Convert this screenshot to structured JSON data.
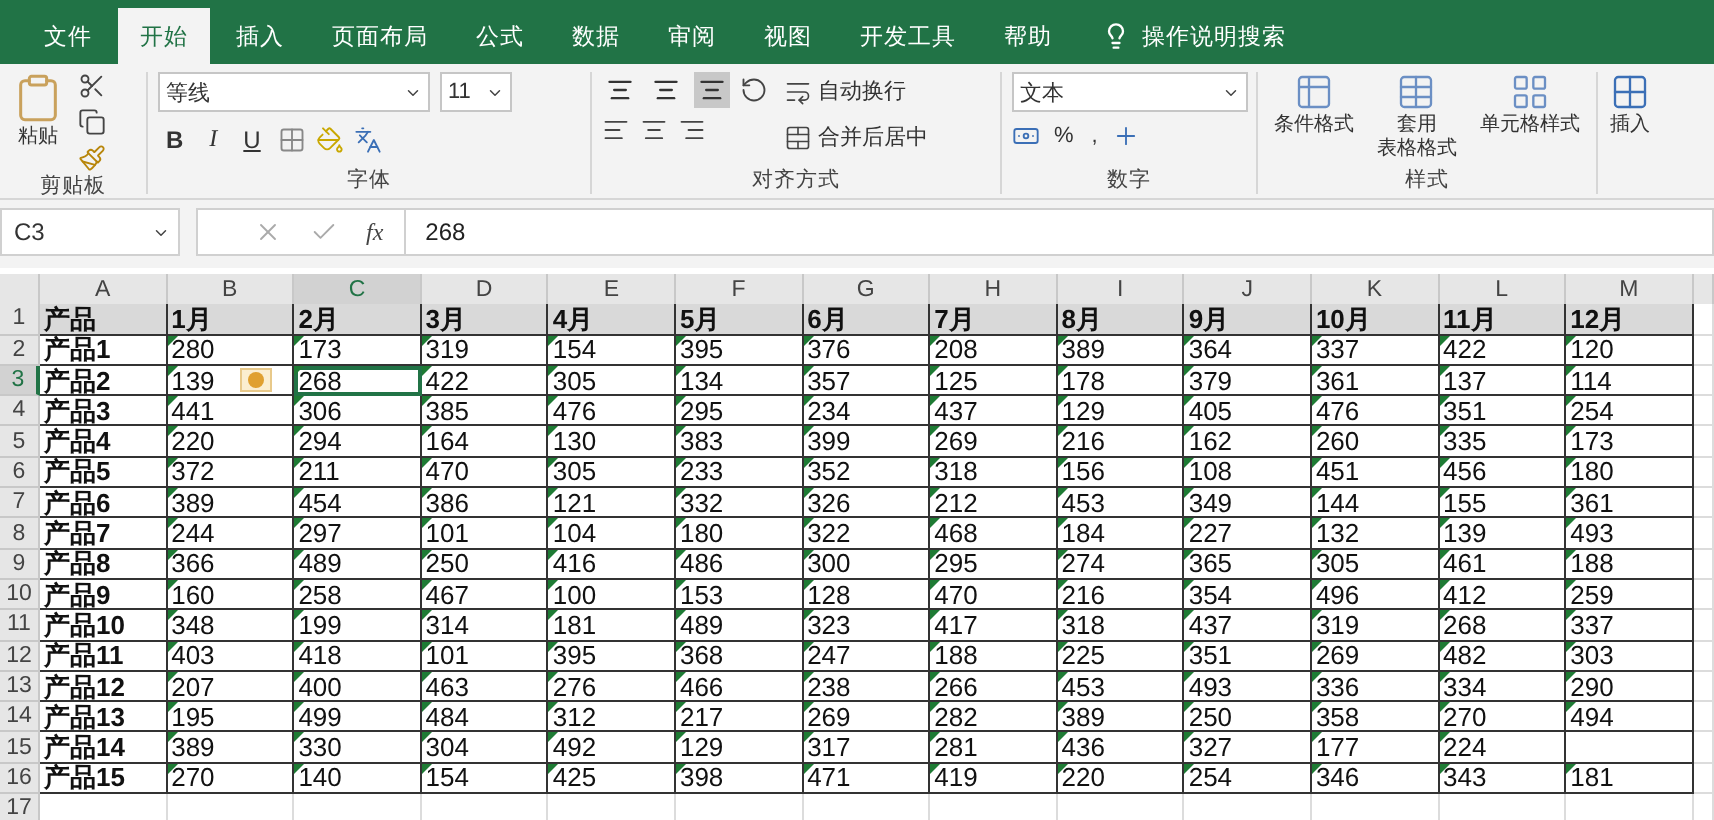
{
  "tabs": [
    {
      "label": "文件",
      "selected": false
    },
    {
      "label": "开始",
      "selected": true
    },
    {
      "label": "插入",
      "selected": false
    },
    {
      "label": "页面布局",
      "selected": false
    },
    {
      "label": "公式",
      "selected": false
    },
    {
      "label": "数据",
      "selected": false
    },
    {
      "label": "审阅",
      "selected": false
    },
    {
      "label": "视图",
      "selected": false
    },
    {
      "label": "开发工具",
      "selected": false
    },
    {
      "label": "帮助",
      "selected": false
    }
  ],
  "tell_me": "操作说明搜索",
  "ribbon": {
    "clipboard": {
      "paste": "粘贴",
      "label": "剪贴板"
    },
    "font": {
      "name": "等线",
      "size": "11",
      "bold": "B",
      "italic": "I",
      "underline": "U",
      "label": "字体"
    },
    "alignment": {
      "vertical": [
        {
          "selected": false
        },
        {
          "selected": false
        },
        {
          "selected": true
        }
      ],
      "wrap": "自动换行",
      "merge": "合并后居中",
      "label": "对齐方式"
    },
    "number": {
      "format": "文本",
      "percent": "%",
      "comma": ",",
      "label": "数字"
    },
    "styles": {
      "buttons": [
        {
          "lines": [
            "条件格式"
          ]
        },
        {
          "lines": [
            "套用",
            "表格格式"
          ]
        },
        {
          "lines": [
            "单元格样式"
          ]
        }
      ],
      "label": "样式"
    },
    "cells": {
      "insert": "插入"
    }
  },
  "formula_bar": {
    "name_box": "C3",
    "function_label": "fx",
    "value": "268"
  },
  "grid": {
    "text_number_flags": true,
    "columns": [
      {
        "label": "A",
        "selected": false
      },
      {
        "label": "B",
        "selected": false
      },
      {
        "label": "C",
        "selected": true
      },
      {
        "label": "D",
        "selected": false
      },
      {
        "label": "E",
        "selected": false
      },
      {
        "label": "F",
        "selected": false
      },
      {
        "label": "G",
        "selected": false
      },
      {
        "label": "H",
        "selected": false
      },
      {
        "label": "I",
        "selected": false
      },
      {
        "label": "J",
        "selected": false
      },
      {
        "label": "K",
        "selected": false
      },
      {
        "label": "L",
        "selected": false
      },
      {
        "label": "M",
        "selected": false
      }
    ],
    "rows": [
      {
        "label": "1",
        "selected": false,
        "warning": false,
        "cells": [
          "产品",
          "1月",
          "2月",
          "3月",
          "4月",
          "5月",
          "6月",
          "7月",
          "8月",
          "9月",
          "10月",
          "11月",
          "12月"
        ]
      },
      {
        "label": "2",
        "selected": false,
        "warning": false,
        "cells": [
          "产品1",
          "280",
          "173",
          "319",
          "154",
          "395",
          "376",
          "208",
          "389",
          "364",
          "337",
          "422",
          "120"
        ]
      },
      {
        "label": "3",
        "selected": true,
        "warning": true,
        "cells": [
          "产品2",
          "139",
          "268",
          "422",
          "305",
          "134",
          "357",
          "125",
          "178",
          "379",
          "361",
          "137",
          "114"
        ]
      },
      {
        "label": "4",
        "selected": false,
        "warning": false,
        "cells": [
          "产品3",
          "441",
          "306",
          "385",
          "476",
          "295",
          "234",
          "437",
          "129",
          "405",
          "476",
          "351",
          "254"
        ]
      },
      {
        "label": "5",
        "selected": false,
        "warning": false,
        "cells": [
          "产品4",
          "220",
          "294",
          "164",
          "130",
          "383",
          "399",
          "269",
          "216",
          "162",
          "260",
          "335",
          "173"
        ]
      },
      {
        "label": "6",
        "selected": false,
        "warning": false,
        "cells": [
          "产品5",
          "372",
          "211",
          "470",
          "305",
          "233",
          "352",
          "318",
          "156",
          "108",
          "451",
          "456",
          "180"
        ]
      },
      {
        "label": "7",
        "selected": false,
        "warning": false,
        "cells": [
          "产品6",
          "389",
          "454",
          "386",
          "121",
          "332",
          "326",
          "212",
          "453",
          "349",
          "144",
          "155",
          "361"
        ]
      },
      {
        "label": "8",
        "selected": false,
        "warning": false,
        "cells": [
          "产品7",
          "244",
          "297",
          "101",
          "104",
          "180",
          "322",
          "468",
          "184",
          "227",
          "132",
          "139",
          "493"
        ]
      },
      {
        "label": "9",
        "selected": false,
        "warning": false,
        "cells": [
          "产品8",
          "366",
          "489",
          "250",
          "416",
          "486",
          "300",
          "295",
          "274",
          "365",
          "305",
          "461",
          "188"
        ]
      },
      {
        "label": "10",
        "selected": false,
        "warning": false,
        "cells": [
          "产品9",
          "160",
          "258",
          "467",
          "100",
          "153",
          "128",
          "470",
          "216",
          "354",
          "496",
          "412",
          "259"
        ]
      },
      {
        "label": "11",
        "selected": false,
        "warning": false,
        "cells": [
          "产品10",
          "348",
          "199",
          "314",
          "181",
          "489",
          "323",
          "417",
          "318",
          "437",
          "319",
          "268",
          "337"
        ]
      },
      {
        "label": "12",
        "selected": false,
        "warning": false,
        "cells": [
          "产品11",
          "403",
          "418",
          "101",
          "395",
          "368",
          "247",
          "188",
          "225",
          "351",
          "269",
          "482",
          "303"
        ]
      },
      {
        "label": "13",
        "selected": false,
        "warning": false,
        "cells": [
          "产品12",
          "207",
          "400",
          "463",
          "276",
          "466",
          "238",
          "266",
          "453",
          "493",
          "336",
          "334",
          "290"
        ]
      },
      {
        "label": "14",
        "selected": false,
        "warning": false,
        "cells": [
          "产品13",
          "195",
          "499",
          "484",
          "312",
          "217",
          "269",
          "282",
          "389",
          "250",
          "358",
          "270",
          "494"
        ]
      },
      {
        "label": "15",
        "selected": false,
        "warning": false,
        "cells": [
          "产品14",
          "389",
          "330",
          "304",
          "492",
          "129",
          "317",
          "281",
          "436",
          "327",
          "177",
          "224",
          null
        ]
      },
      {
        "label": "16",
        "selected": false,
        "warning": false,
        "cells": [
          "产品15",
          "270",
          "140",
          "154",
          "425",
          "398",
          "471",
          "419",
          "220",
          "254",
          "346",
          "343",
          "181"
        ]
      },
      {
        "label": "17",
        "selected": false,
        "warning": false,
        "cells": []
      }
    ]
  }
}
